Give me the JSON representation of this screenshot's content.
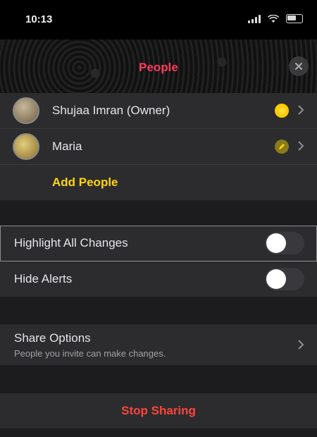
{
  "status": {
    "time": "10:13"
  },
  "sheet": {
    "title": "People"
  },
  "people": [
    {
      "name": "Shujaa Imran (Owner)",
      "permission_icon": "sun-icon"
    },
    {
      "name": "Maria",
      "permission_icon": "pencil-icon"
    }
  ],
  "add_people_label": "Add People",
  "toggles": [
    {
      "label": "Highlight All Changes",
      "on": false
    },
    {
      "label": "Hide Alerts",
      "on": false
    }
  ],
  "share_options": {
    "title": "Share Options",
    "subtitle": "People you invite can make changes."
  },
  "stop_sharing_label": "Stop Sharing",
  "colors": {
    "accent": "#ffd60a",
    "destructive": "#ff453a",
    "title": "#ff3b5c",
    "background": "#1c1c1e",
    "cell": "#2c2c2e"
  }
}
